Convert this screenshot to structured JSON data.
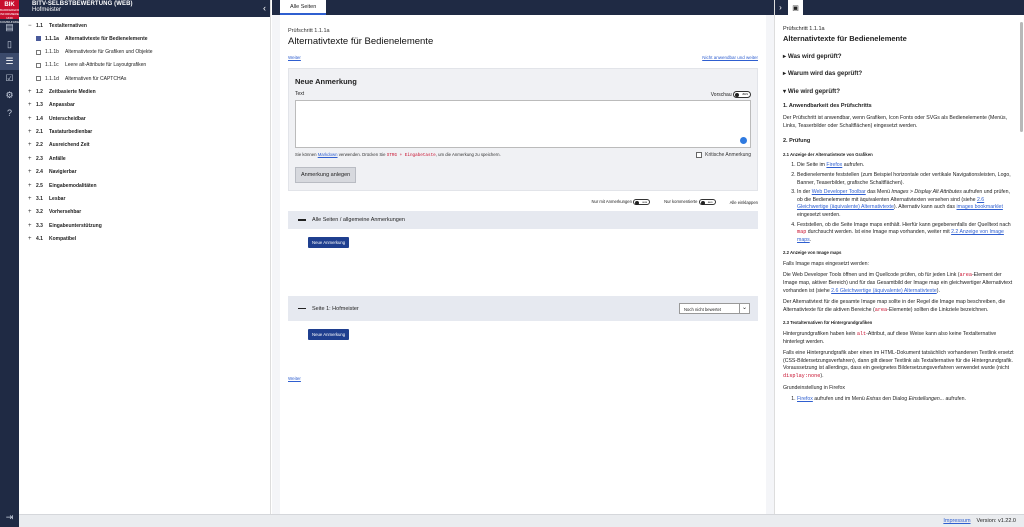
{
  "rail": {
    "logo_text": "BIK",
    "logo_sub": "BARRIEREFREI INFORMIEREN UND KOMMUNIZIEREN",
    "icons": [
      "clipboard-icon",
      "document-icon",
      "list-icon",
      "checklist-icon",
      "settings-icon",
      "help-icon",
      "logout-icon"
    ]
  },
  "sidebar": {
    "title": "BITV-SELBSTBEWERTUNG (WEB)",
    "subtitle": "Hofmeister",
    "items": [
      {
        "pm": "−",
        "num": "1.1",
        "label": "Textalternativen"
      },
      {
        "num": "1.1.1a",
        "label": "Alternativtexte für Bedienelemente",
        "active": true
      },
      {
        "num": "1.1.1b",
        "label": "Alternativtexte für Grafiken und Objekte"
      },
      {
        "num": "1.1.1c",
        "label": "Leere alt-Attribute für Layoutgrafiken"
      },
      {
        "num": "1.1.1d",
        "label": "Alternativen für CAPTCHAs"
      },
      {
        "pm": "+",
        "num": "1.2",
        "label": "Zeitbasierte Medien"
      },
      {
        "pm": "+",
        "num": "1.3",
        "label": "Anpassbar"
      },
      {
        "pm": "+",
        "num": "1.4",
        "label": "Unterscheidbar"
      },
      {
        "pm": "+",
        "num": "2.1",
        "label": "Tastaturbedienbar"
      },
      {
        "pm": "+",
        "num": "2.2",
        "label": "Ausreichend Zeit"
      },
      {
        "pm": "+",
        "num": "2.3",
        "label": "Anfälle"
      },
      {
        "pm": "+",
        "num": "2.4",
        "label": "Navigierbar"
      },
      {
        "pm": "+",
        "num": "2.5",
        "label": "Eingabemodalitäten"
      },
      {
        "pm": "+",
        "num": "3.1",
        "label": "Lesbar"
      },
      {
        "pm": "+",
        "num": "3.2",
        "label": "Vorhersehbar"
      },
      {
        "pm": "+",
        "num": "3.3",
        "label": "Eingabeunterstützung"
      },
      {
        "pm": "+",
        "num": "4.1",
        "label": "Kompatibel"
      }
    ]
  },
  "main": {
    "tab": "Alle Seiten",
    "crumb": "Prüfschritt 1.1.1a",
    "title": "Alternativtexte für Bedienelemente",
    "weiter": "Weiter",
    "not_applicable": "Nicht anwendbar und weiter",
    "form": {
      "heading": "Neue Anmerkung",
      "text_label": "Text",
      "preview_label": "Vorschau",
      "toggle_state": "aus",
      "hint_before": "Sie können ",
      "hint_link": "Markdown",
      "hint_mid": " verwenden. Drücken Sie ",
      "hint_kbd": "STRG + Eingabetaste",
      "hint_after": ", um die Anmerkung zu speichern.",
      "critical_label": "Kritische Anmerkung",
      "submit": "Anmerkung anlegen"
    },
    "filters": {
      "only_notes": "Nur mit Anmerkungen",
      "only_commented": "Nur kommentierte",
      "collapse_all": "Alle einklappen",
      "toggle_state": "aus"
    },
    "section_all": "Alle Seiten / allgemeine Anmerkungen",
    "new_note": "Neue Anmerkung",
    "section_page": "Seite 1: Hofmeister",
    "status_select": "Noch nicht bewertet",
    "weiter_bottom": "Weiter"
  },
  "right": {
    "crumb": "Prüfschritt 1.1.1a",
    "title": "Alternativtexte für Bedienelemente",
    "acc1": "Was wird geprüft?",
    "acc2": "Warum wird das geprüft?",
    "acc3": "Wie wird geprüft?",
    "h_applicability": "1. Anwendbarkeit des Prüfschritts",
    "p_applicability": "Der Prüfschritt ist anwendbar, wenn Grafiken, Icon Fonts oder SVGs als Bedienelemente (Menüs, Links, Teaserbilder oder Schaltflächen) eingesetzt werden.",
    "h_check": "2. Prüfung",
    "h_2_1": "2.1 Anzeige der Alternativtexte von Grafiken",
    "s1_a": "Die Seite im ",
    "s1_link": "Firefox",
    "s1_b": " aufrufen.",
    "s2": "Bedienelemente feststellen (zum Beispiel horizontale oder vertikale Navigationsleisten, Logo, Banner, Teaserbilder, grafische Schaltflächen).",
    "s3_a": "In der ",
    "s3_link1": "Web Developer Toolbar",
    "s3_b": " das Menü ",
    "s3_em": "Images > Display Alt Attributes",
    "s3_c": " aufrufen und prüfen, ob die Bedienelemente mit äquivalenten Alternativtexten versehen sind (siehe ",
    "s3_link2": "2.6 Gleichwertige (äquivalente) Alternativtexte",
    "s3_d": "). Alternativ kann auch das ",
    "s3_link3": "images bookmarklet",
    "s3_e": " eingesetzt werden.",
    "s4_a": "Feststellen, ob die Seite Image maps enthält. Hierfür kann gegebenenfalls der Quelltext nach ",
    "s4_code": "map",
    "s4_b": " durchsucht werden. Ist eine Image map vorhanden, weiter mit ",
    "s4_link": "2.2 Anzeige von Image maps",
    "s4_c": ".",
    "h_2_2": "2.2 Anzeige von Image maps",
    "p_maps_intro": "Falls Image maps eingesetzt werden:",
    "p_maps_a": "Die Web Developer Tools öffnen und im Quellcode prüfen, ob für jeden Link (",
    "p_maps_code": "area",
    "p_maps_b": "-Element der Image map, aktiver Bereich) und für das Gesamtbild der Image map ein gleichwertiger Alternativtext vorhanden ist (siehe ",
    "p_maps_link": "2.6 Gleichwertige (äquivalente) Alternativtexte",
    "p_maps_c": ").",
    "p_maps2_a": "Der Alternativtext für die gesamte Image map sollte in der Regel die Image map beschreiben, die Alternativtexte für die aktiven Bereiche (",
    "p_maps2_code": "area",
    "p_maps2_b": "-Elemente) sollten die Linkziele bezeichnen.",
    "h_2_3": "2.3 Textalternativen für Hintergrundgrafiken",
    "p_bg1_a": "Hintergrundgrafiken haben kein ",
    "p_bg1_code": "alt",
    "p_bg1_b": "-Attribut, auf diese Weise kann also keine Textalternative hinterlegt werden.",
    "p_bg2_a": "Falls eine Hintergrundgrafik aber einen im HTML-Dokument tatsächlich vorhandenen Textlink ersetzt (CSS-Bildersetzungsverfahren), dann gilt dieser Textlink als Textalternative für die Hintergrundgrafik. Voraussetzung ist allerdings, dass ein geeignetes Bildersetzungsverfahren verwendet wurde (nicht ",
    "p_bg2_code": "display:none",
    "p_bg2_b": ").",
    "p_ff": "Grundeinstellung in Firefox",
    "ff1_link": "Firefox",
    "ff1_a": " aufrufen und im Menü ",
    "ff1_em1": "Extras",
    "ff1_b": " den Dialog ",
    "ff1_em2": "Einstellungen...",
    "ff1_c": " aufrufen."
  },
  "footer": {
    "impressum": "Impressum",
    "version": "Version: v1.22.0"
  }
}
